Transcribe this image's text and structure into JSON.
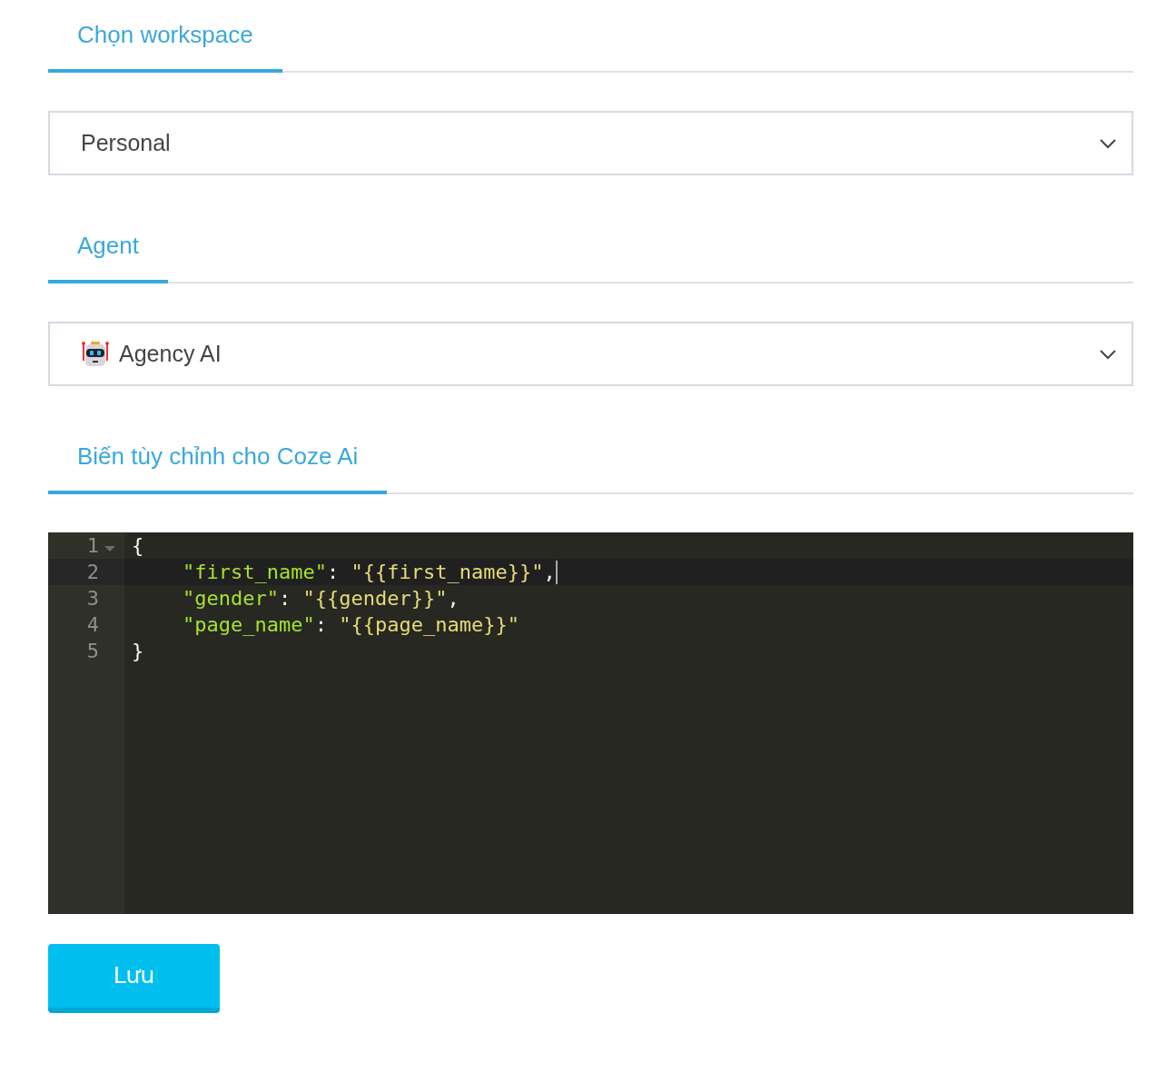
{
  "sections": [
    {
      "tab": {
        "label": "Chọn workspace",
        "selected": true
      },
      "kind": "select",
      "select": {
        "value": "Personal",
        "has_icon": false
      }
    },
    {
      "tab": {
        "label": "Agent",
        "selected": true
      },
      "kind": "select",
      "select": {
        "value": "Agency AI",
        "has_icon": true
      }
    },
    {
      "tab": {
        "label": "Biến tùy chỉnh cho Coze Ai",
        "selected": true
      },
      "kind": "editor",
      "editor": {
        "lines": [
          {
            "number": "1",
            "foldable": true,
            "active": false,
            "indented": false,
            "tokens": [
              {
                "kind": "punct",
                "text": "{"
              }
            ]
          },
          {
            "number": "2",
            "foldable": false,
            "active": true,
            "indented": true,
            "tokens": [
              {
                "kind": "key",
                "text": "\"first_name\""
              },
              {
                "kind": "punct",
                "text": ": "
              },
              {
                "kind": "string",
                "text": "\"{{first_name}}\""
              },
              {
                "kind": "punct",
                "text": ","
              }
            ]
          },
          {
            "number": "3",
            "foldable": false,
            "active": false,
            "indented": true,
            "tokens": [
              {
                "kind": "key",
                "text": "\"gender\""
              },
              {
                "kind": "punct",
                "text": ": "
              },
              {
                "kind": "string",
                "text": "\"{{gender}}\""
              },
              {
                "kind": "punct",
                "text": ","
              }
            ]
          },
          {
            "number": "4",
            "foldable": false,
            "active": false,
            "indented": true,
            "tokens": [
              {
                "kind": "key",
                "text": "\"page_name\""
              },
              {
                "kind": "punct",
                "text": ": "
              },
              {
                "kind": "string",
                "text": "\"{{page_name}}\""
              }
            ]
          },
          {
            "number": "5",
            "foldable": false,
            "active": false,
            "indented": false,
            "tokens": [
              {
                "kind": "punct",
                "text": "}"
              }
            ]
          }
        ]
      }
    }
  ],
  "save_button": {
    "label": "Lưu"
  }
}
